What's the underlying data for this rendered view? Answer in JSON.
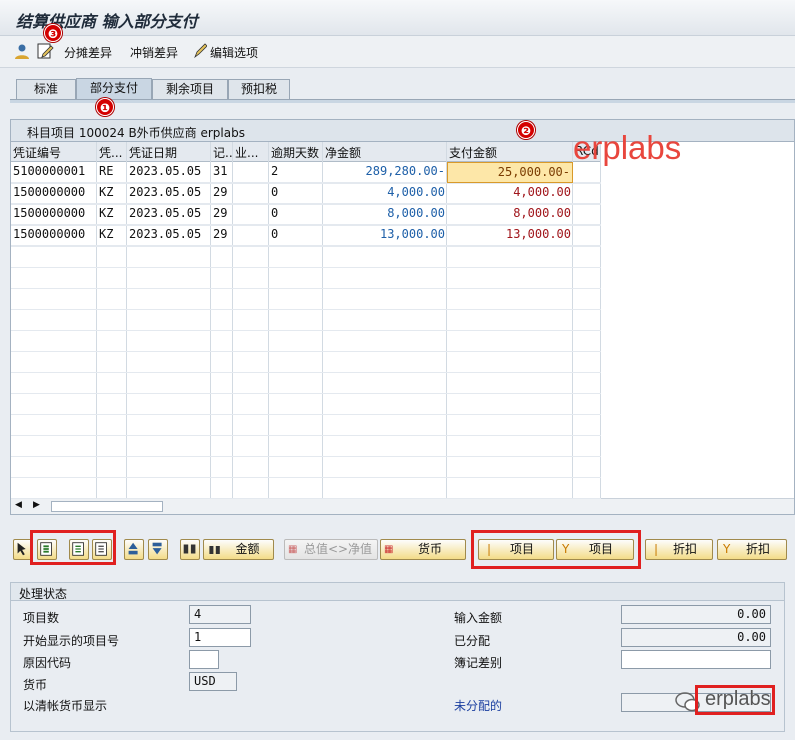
{
  "window": {
    "title": "结算供应商 输入部分支付"
  },
  "toolbar": {
    "items": [
      "分摊差异",
      "冲销差异",
      "编辑选项"
    ]
  },
  "callouts": [
    "❶",
    "❷",
    "❸"
  ],
  "tabs": [
    "标准",
    "部分支付",
    "剩余项目",
    "预扣税"
  ],
  "watermark": "erplabs",
  "grid": {
    "header": "科目项目 100024 B外币供应商 erplabs",
    "columns": [
      "凭证编号",
      "凭...",
      "凭证日期",
      "记...",
      "业...",
      "逾期天数",
      "净金额",
      "支付金额",
      "RCd"
    ],
    "rows": [
      [
        "5100000001",
        "RE",
        "2023.05.05",
        "31",
        "",
        "2",
        "289,280.00-",
        "25,000.00-",
        ""
      ],
      [
        "1500000000",
        "KZ",
        "2023.05.05",
        "29",
        "",
        "0",
        "4,000.00",
        "4,000.00",
        ""
      ],
      [
        "1500000000",
        "KZ",
        "2023.05.05",
        "29",
        "",
        "0",
        "8,000.00",
        "8,000.00",
        ""
      ],
      [
        "1500000000",
        "KZ",
        "2023.05.05",
        "29",
        "",
        "0",
        "13,000.00",
        "13,000.00",
        ""
      ]
    ]
  },
  "buttons": {
    "amount": "金额",
    "gross_net": "总值<>净值",
    "currency": "货币",
    "items1": "项目",
    "items2": "项目",
    "discount1": "折扣",
    "discount2": "折扣"
  },
  "status": {
    "title": "处理状态",
    "items_count_label": "项目数",
    "items_count": "4",
    "first_item_label": "开始显示的项目号",
    "first_item": "1",
    "reason_label": "原因代码",
    "reason": "",
    "currency_label": "货币",
    "currency": "USD",
    "clearing_label": "以清帐货币显示",
    "entered_label": "输入金额",
    "entered": "0.00",
    "assigned_label": "已分配",
    "assigned": "0.00",
    "posting_diff_label": "簿记差别",
    "posting_diff": "",
    "unassigned_label": "未分配的",
    "unassigned": ""
  },
  "colors": {
    "accent_red": "#e02020",
    "callout_red": "#d40000",
    "blue_text": "#1d5fa8",
    "red_text": "#a0151b"
  }
}
